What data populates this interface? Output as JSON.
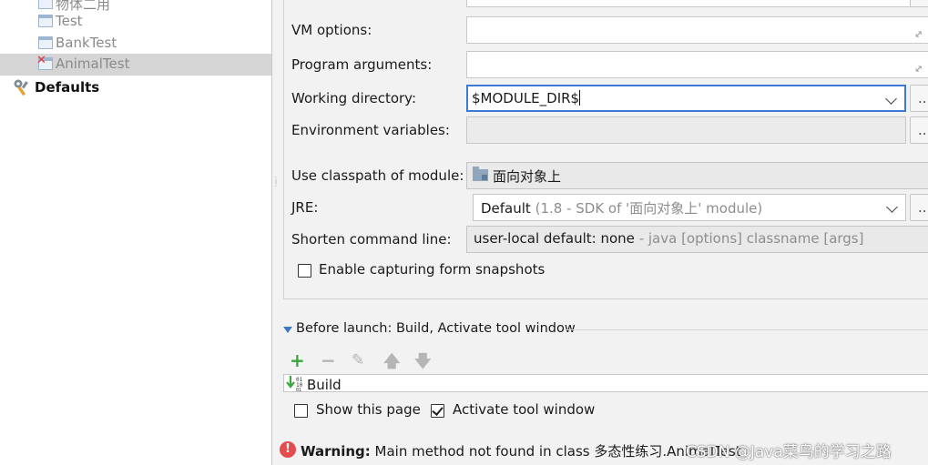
{
  "tree": {
    "items": [
      {
        "label": "物体二用"
      },
      {
        "label": "Test"
      },
      {
        "label": "BankTest"
      },
      {
        "label": "AnimalTest"
      }
    ],
    "defaults_label": "Defaults"
  },
  "form": {
    "vm_options_label": "VM options:",
    "vm_options_value": "",
    "program_arguments_label": "Program arguments:",
    "program_arguments_value": "",
    "working_directory_label": "Working directory:",
    "working_directory_value": "$MODULE_DIR$",
    "environment_variables_label": "Environment variables:",
    "environment_variables_value": "",
    "browse_label": "...",
    "classpath_label": "Use classpath of module:",
    "classpath_value": "面向对象上",
    "jre_label": "JRE:",
    "jre_value": "Default",
    "jre_hint": "(1.8 - SDK of '面向对象上' module)",
    "shorten_label": "Shorten command line:",
    "shorten_value": "user-local default: none",
    "shorten_hint": "- java [options] classname [args]",
    "snapshots_label": "Enable capturing form snapshots",
    "snapshots_checked": false
  },
  "before_launch": {
    "title": "Before launch: Build, Activate tool window",
    "tasks": [
      "Build"
    ],
    "show_page_label": "Show this page",
    "show_page_checked": false,
    "activate_label": "Activate tool window",
    "activate_checked": true
  },
  "warning": {
    "prefix": "Warning:",
    "message": "Main method not found in class 多态性练习.AnimalTest"
  },
  "watermark": "CSDN @Java菜鸟的学习之路",
  "colors": {
    "accent": "#3d7ad8",
    "error": "#e34d4d",
    "add": "#3aa53a"
  }
}
